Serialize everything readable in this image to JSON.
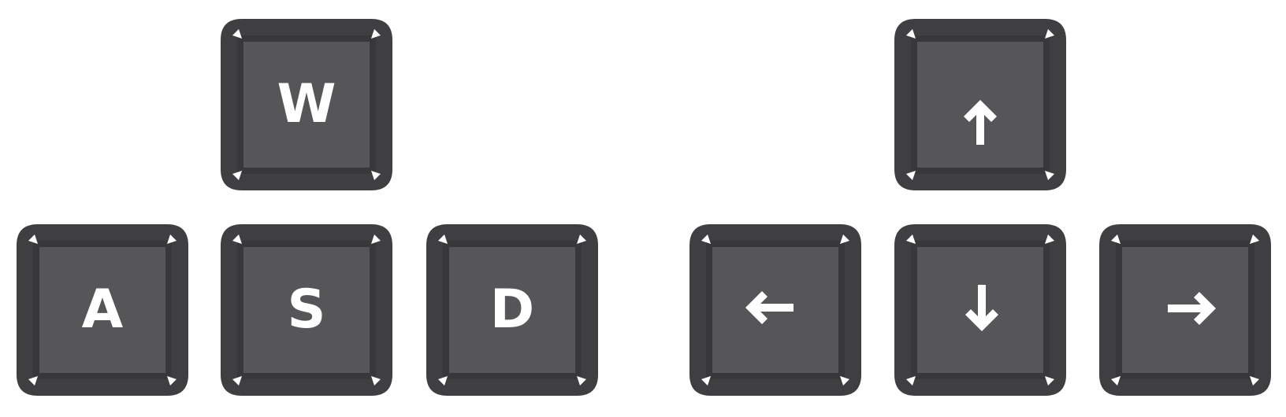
{
  "keys": {
    "w": {
      "label": "W"
    },
    "a": {
      "label": "A"
    },
    "s": {
      "label": "S"
    },
    "d": {
      "label": "D"
    },
    "up": {
      "icon": "arrow-up-icon"
    },
    "left": {
      "icon": "arrow-left-icon"
    },
    "down": {
      "icon": "arrow-down-icon"
    },
    "right": {
      "icon": "arrow-right-icon"
    }
  },
  "colors": {
    "key_rim": "#3f3f41",
    "key_bevel": "#38383a",
    "key_face": "#565659",
    "glyph": "#ffffff",
    "background": "#ffffff"
  }
}
